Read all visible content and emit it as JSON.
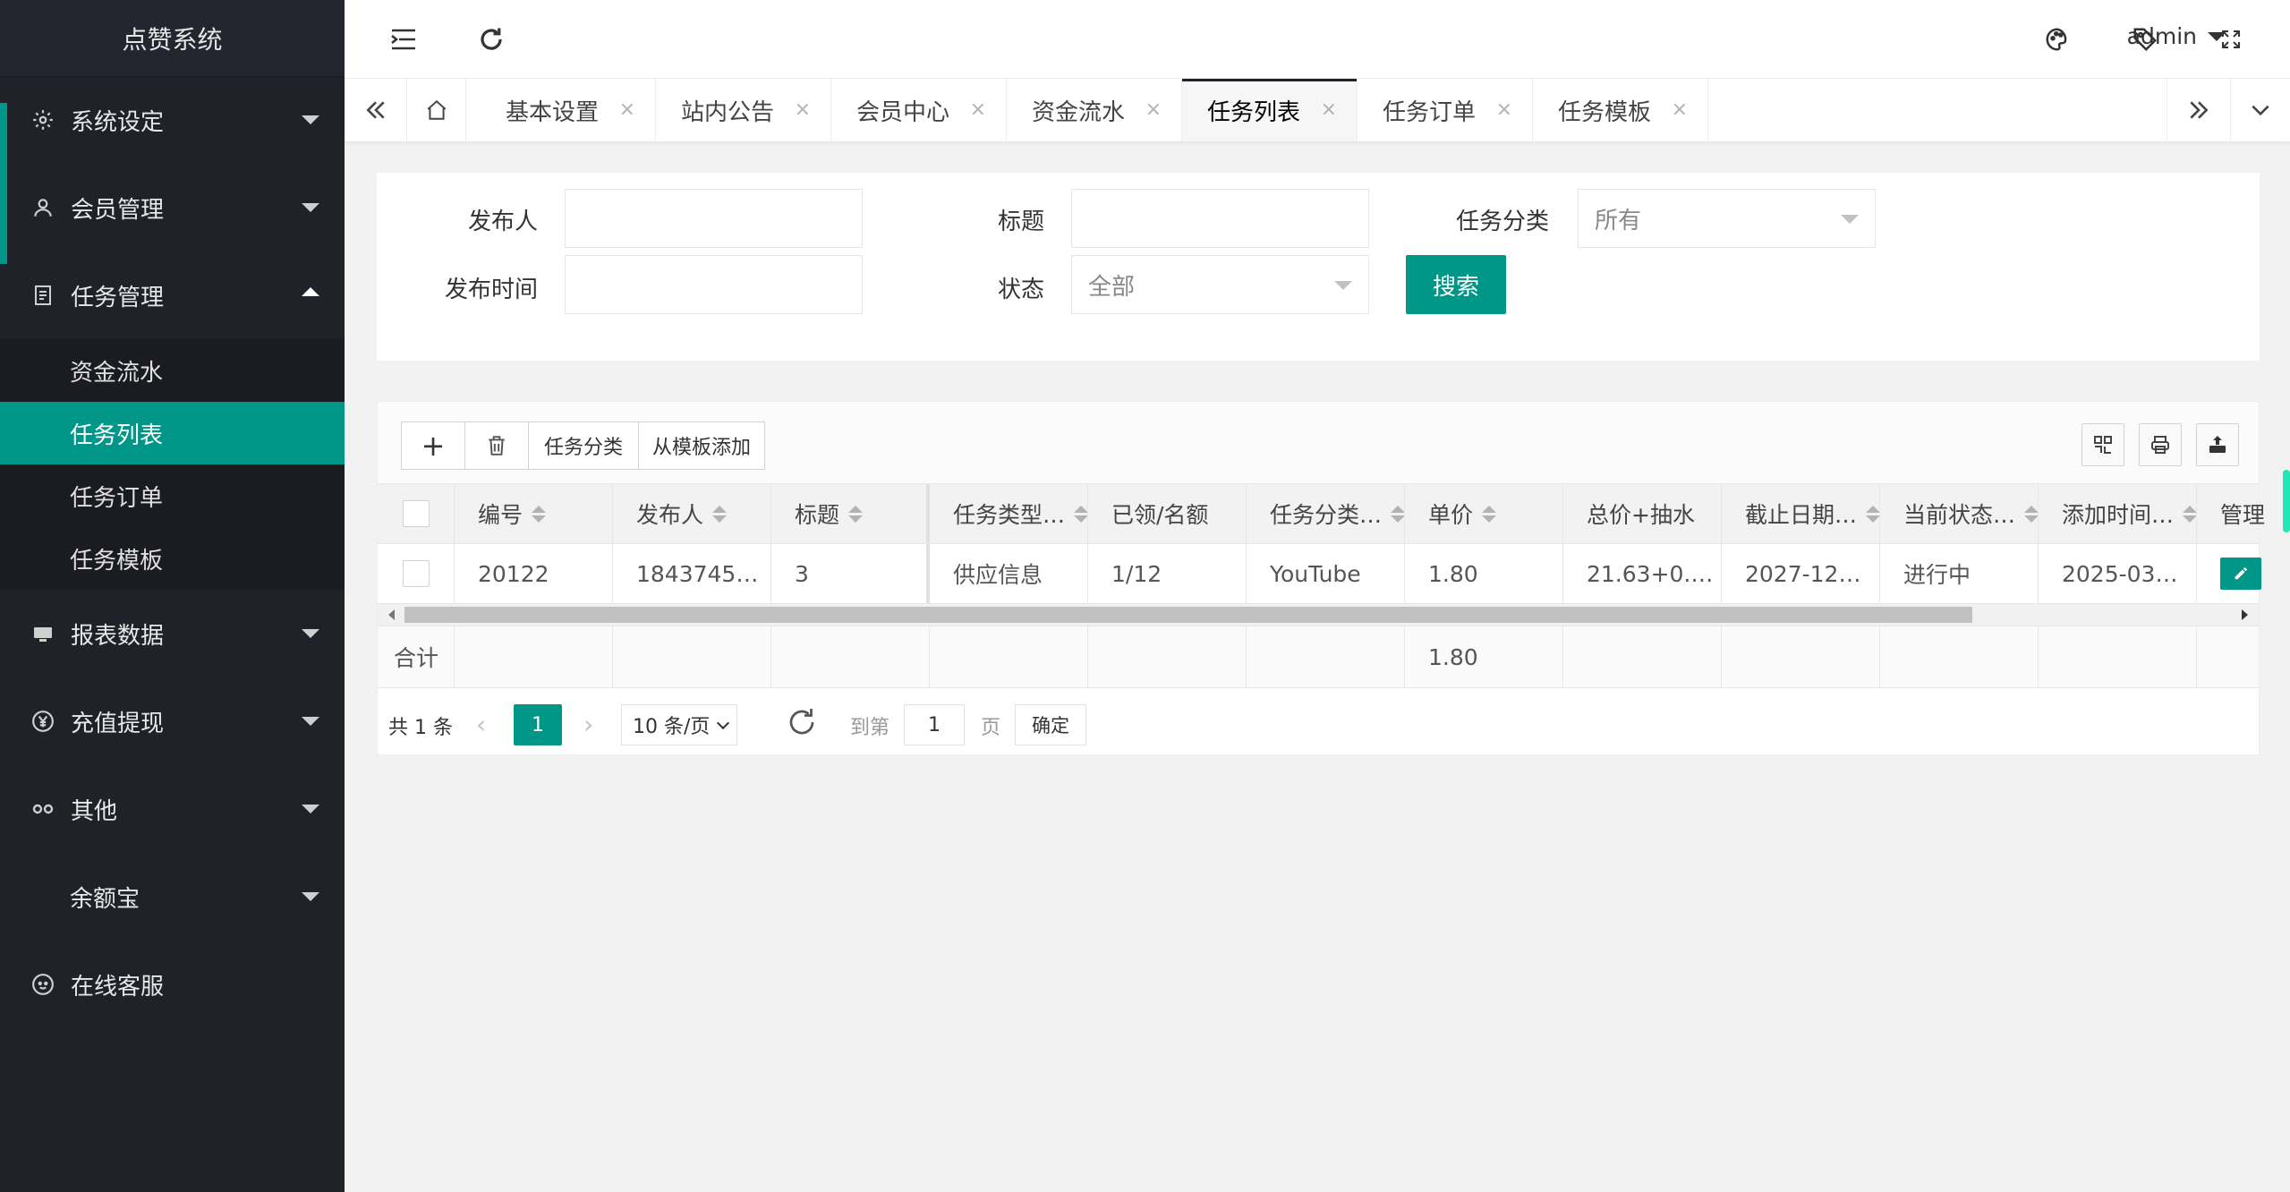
{
  "app": {
    "title": "点赞系统"
  },
  "sidebar": {
    "items": [
      {
        "label": "系统设定",
        "icon": "gear-icon"
      },
      {
        "label": "会员管理",
        "icon": "user-icon"
      },
      {
        "label": "任务管理",
        "icon": "document-icon",
        "open": true,
        "children": [
          "资金流水",
          "任务列表",
          "任务订单",
          "任务模板"
        ],
        "active_child": "任务列表"
      },
      {
        "label": "报表数据",
        "icon": "chart-icon"
      },
      {
        "label": "充值提现",
        "icon": "yen-icon"
      },
      {
        "label": "其他",
        "icon": "link-icon"
      },
      {
        "label": "余额宝",
        "icon": ""
      },
      {
        "label": "在线客服",
        "icon": "chat-icon"
      }
    ]
  },
  "header": {
    "user": "admin",
    "icons": [
      "menu-fold-icon",
      "refresh-icon",
      "theme-icon",
      "tag-icon",
      "fullscreen-icon"
    ]
  },
  "tabs": {
    "items": [
      "基本设置",
      "站内公告",
      "会员中心",
      "资金流水",
      "任务列表",
      "任务订单",
      "任务模板"
    ],
    "active": "任务列表"
  },
  "search": {
    "publisher_label": "发布人",
    "publisher_value": "",
    "title_label": "标题",
    "title_value": "",
    "category_label": "任务分类",
    "category_value": "所有",
    "time_label": "发布时间",
    "time_value": "",
    "status_label": "状态",
    "status_value": "全部",
    "button_label": "搜索"
  },
  "toolbar": {
    "add_label": "+",
    "category_label": "任务分类",
    "template_label": "从模板添加"
  },
  "table": {
    "columns": [
      "编号",
      "发布人",
      "标题",
      "任务类型…",
      "已领/名额",
      "任务分类…",
      "单价",
      "总价+抽水",
      "截止日期…",
      "当前状态…",
      "添加时间…",
      "管理"
    ],
    "rows": [
      [
        "20122",
        "1843745…",
        "3",
        "供应信息",
        "1/12",
        "YouTube",
        "1.80",
        "21.63+0.…",
        "2027-12…",
        "进行中",
        "2025-03…",
        ""
      ]
    ],
    "total_label": "合计",
    "total_price": "1.80"
  },
  "pager": {
    "total": "共 1 条",
    "current": "1",
    "limit": "10 条/页",
    "goto_label": "到第",
    "goto_value": "1",
    "page_unit": "页",
    "confirm_label": "确定"
  },
  "colors": {
    "accent": "#009688",
    "sidebar_bg": "#20222a"
  }
}
